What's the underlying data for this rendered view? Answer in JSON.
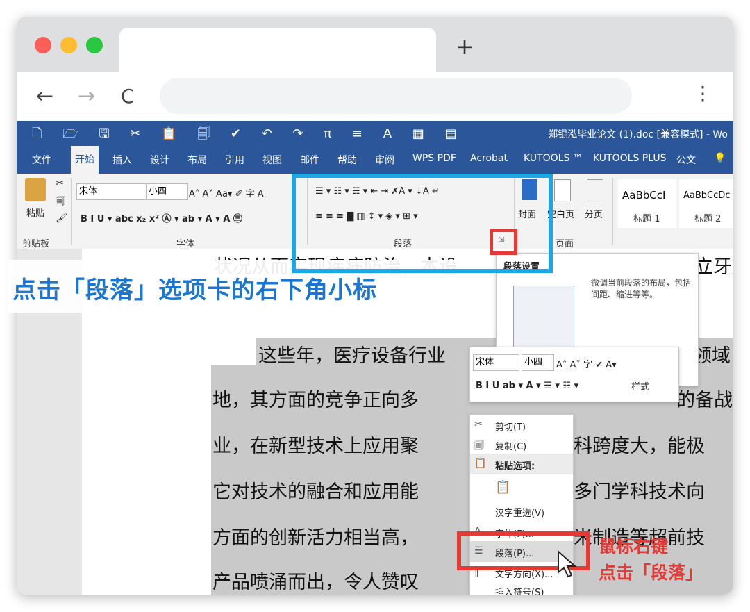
{
  "browser": {
    "new_tab": "+",
    "nav": {
      "back": "←",
      "forward": "→",
      "reload": "C",
      "menu": "⋮"
    }
  },
  "word": {
    "title": "郑锟泓毕业论文 (1).doc [兼容模式] - Wo",
    "qat_icons": "🗋 🗁 🖫 ✂ 📋 🗐 ✔ ↶ ↷ π ≡ A ▦ ▤",
    "menu": [
      "文件",
      "开始",
      "插入",
      "设计",
      "布局",
      "引用",
      "视图",
      "邮件",
      "帮助",
      "审阅",
      "WPS PDF",
      "Acrobat",
      "KUTOOLS ™",
      "KUTOOLS PLUS",
      "公文"
    ],
    "ribbon": {
      "paste_label": "粘贴",
      "clipboard_label": "剪贴板",
      "font_name": "宋体",
      "font_size": "小四",
      "font_group_label": "字体",
      "paragraph_group_label": "段落",
      "cover_label": "封面",
      "blank_page_label": "空白页",
      "page_break_label": "分页",
      "page_group_label": "页面",
      "style1_sample": "AaBbCcI",
      "style1_name": "标题 1",
      "style2_sample": "AaBbCcDc",
      "style2_name": "标题 2",
      "font_row1": "A˄ A˅  Aa▾  ✐ 字 A",
      "font_row2": "B  I  U ▾ abc x₂ x²  Ⓐ ▾ ab ▾ A ▾ A ㊂",
      "para_row1": "☰ ▾ ☷ ▾ ☵ ▾  ⇤ ⇥  ✗A ▾  ↓A  ↵",
      "para_row2": "≡ ≡ ≡ ▇ ▥  ↕ ▾  ◈ ▾ ⊞ ▾"
    },
    "tooltip": {
      "title": "段落设置",
      "desc": "微调当前段落的布局，包括间距、缩进等等。"
    },
    "mini_toolbar": {
      "font_name": "宋体",
      "font_size": "小四",
      "row1_rest": "A˄ A˅ 字 ✔  A▾",
      "row2": "B  I  U  ab ▾  A ▾  ☰ ▾  ☷ ▾",
      "styles_label": "样式"
    },
    "context_menu": [
      {
        "icon": "✂",
        "label": "剪切(T)"
      },
      {
        "icon": "🗐",
        "label": "复制(C)"
      },
      {
        "icon": "📋",
        "label": "粘贴选项:"
      },
      {
        "icon": "📋",
        "label": ""
      },
      {
        "icon": "",
        "label": "汉字重选(V)"
      },
      {
        "icon": "A",
        "label": "字体(F)..."
      },
      {
        "icon": "☰",
        "label": "段落(P)..."
      },
      {
        "icon": "‖",
        "label": "文字方向(X)..."
      },
      {
        "icon": "",
        "label": "插入符号(S)"
      }
    ],
    "document_lines": [
      "状况从而实现疾病防治，本设",
      "这些年，医疗设备行业",
      "地，其方面的竞争正向多",
      "业，在新型技术上应用聚",
      "它对技术的融合和应用能",
      "方面的创新活力相当高，",
      "产品喷涌而出，令人赞叹"
    ],
    "document_right_fragments": [
      "立牙运",
      "领域",
      "的备战",
      "科跨度大，能极",
      "多门学科技术向",
      "米制造等超前技"
    ]
  },
  "annotations": {
    "top_instruction": "点击「段落」选项卡的右下角小标",
    "right_line1": "鼠标右键",
    "right_line2": "点击「段落」"
  }
}
